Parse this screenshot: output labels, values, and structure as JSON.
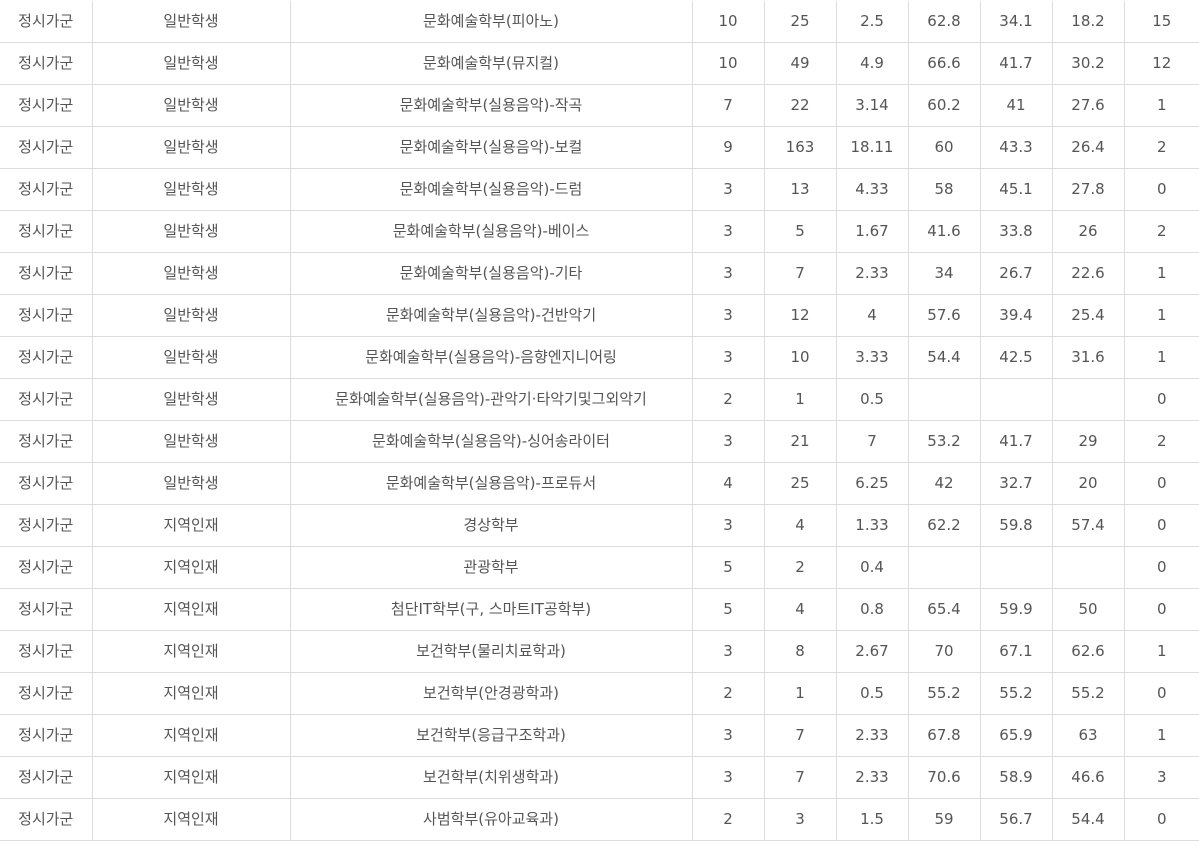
{
  "rows": [
    [
      "정시가군",
      "일반학생",
      "문화예술학부(피아노)",
      "10",
      "25",
      "2.5",
      "62.8",
      "34.1",
      "18.2",
      "15"
    ],
    [
      "정시가군",
      "일반학생",
      "문화예술학부(뮤지컬)",
      "10",
      "49",
      "4.9",
      "66.6",
      "41.7",
      "30.2",
      "12"
    ],
    [
      "정시가군",
      "일반학생",
      "문화예술학부(실용음악)-작곡",
      "7",
      "22",
      "3.14",
      "60.2",
      "41",
      "27.6",
      "1"
    ],
    [
      "정시가군",
      "일반학생",
      "문화예술학부(실용음악)-보컬",
      "9",
      "163",
      "18.11",
      "60",
      "43.3",
      "26.4",
      "2"
    ],
    [
      "정시가군",
      "일반학생",
      "문화예술학부(실용음악)-드럼",
      "3",
      "13",
      "4.33",
      "58",
      "45.1",
      "27.8",
      "0"
    ],
    [
      "정시가군",
      "일반학생",
      "문화예술학부(실용음악)-베이스",
      "3",
      "5",
      "1.67",
      "41.6",
      "33.8",
      "26",
      "2"
    ],
    [
      "정시가군",
      "일반학생",
      "문화예술학부(실용음악)-기타",
      "3",
      "7",
      "2.33",
      "34",
      "26.7",
      "22.6",
      "1"
    ],
    [
      "정시가군",
      "일반학생",
      "문화예술학부(실용음악)-건반악기",
      "3",
      "12",
      "4",
      "57.6",
      "39.4",
      "25.4",
      "1"
    ],
    [
      "정시가군",
      "일반학생",
      "문화예술학부(실용음악)-음향엔지니어링",
      "3",
      "10",
      "3.33",
      "54.4",
      "42.5",
      "31.6",
      "1"
    ],
    [
      "정시가군",
      "일반학생",
      "문화예술학부(실용음악)-관악기·타악기및그외악기",
      "2",
      "1",
      "0.5",
      "",
      "",
      "",
      "0"
    ],
    [
      "정시가군",
      "일반학생",
      "문화예술학부(실용음악)-싱어송라이터",
      "3",
      "21",
      "7",
      "53.2",
      "41.7",
      "29",
      "2"
    ],
    [
      "정시가군",
      "일반학생",
      "문화예술학부(실용음악)-프로듀서",
      "4",
      "25",
      "6.25",
      "42",
      "32.7",
      "20",
      "0"
    ],
    [
      "정시가군",
      "지역인재",
      "경상학부",
      "3",
      "4",
      "1.33",
      "62.2",
      "59.8",
      "57.4",
      "0"
    ],
    [
      "정시가군",
      "지역인재",
      "관광학부",
      "5",
      "2",
      "0.4",
      "",
      "",
      "",
      "0"
    ],
    [
      "정시가군",
      "지역인재",
      "첨단IT학부(구, 스마트IT공학부)",
      "5",
      "4",
      "0.8",
      "65.4",
      "59.9",
      "50",
      "0"
    ],
    [
      "정시가군",
      "지역인재",
      "보건학부(물리치료학과)",
      "3",
      "8",
      "2.67",
      "70",
      "67.1",
      "62.6",
      "1"
    ],
    [
      "정시가군",
      "지역인재",
      "보건학부(안경광학과)",
      "2",
      "1",
      "0.5",
      "55.2",
      "55.2",
      "55.2",
      "0"
    ],
    [
      "정시가군",
      "지역인재",
      "보건학부(응급구조학과)",
      "3",
      "7",
      "2.33",
      "67.8",
      "65.9",
      "63",
      "1"
    ],
    [
      "정시가군",
      "지역인재",
      "보건학부(치위생학과)",
      "3",
      "7",
      "2.33",
      "70.6",
      "58.9",
      "46.6",
      "3"
    ],
    [
      "정시가군",
      "지역인재",
      "사범학부(유아교육과)",
      "2",
      "3",
      "1.5",
      "59",
      "56.7",
      "54.4",
      "0"
    ]
  ]
}
